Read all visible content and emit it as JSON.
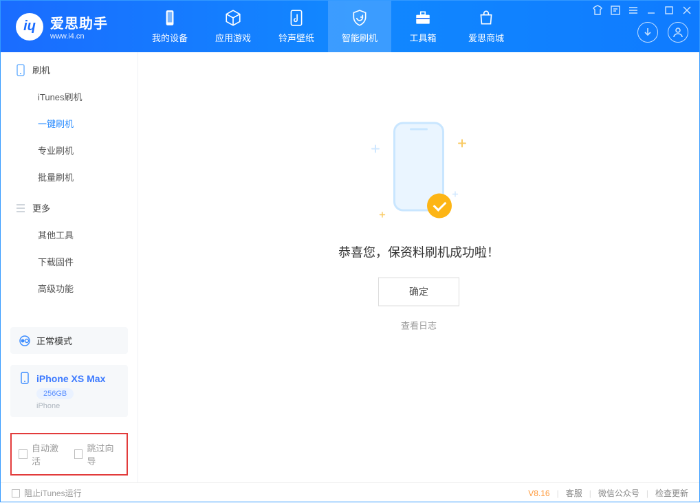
{
  "app": {
    "name": "爱思助手",
    "site": "www.i4.cn"
  },
  "nav": {
    "items": [
      {
        "label": "我的设备"
      },
      {
        "label": "应用游戏"
      },
      {
        "label": "铃声壁纸"
      },
      {
        "label": "智能刷机"
      },
      {
        "label": "工具箱"
      },
      {
        "label": "爱思商城"
      }
    ],
    "active_index": 3
  },
  "sidebar": {
    "sections": [
      {
        "title": "刷机",
        "items": [
          {
            "label": "iTunes刷机"
          },
          {
            "label": "一键刷机"
          },
          {
            "label": "专业刷机"
          },
          {
            "label": "批量刷机"
          }
        ],
        "active_index": 1
      },
      {
        "title": "更多",
        "items": [
          {
            "label": "其他工具"
          },
          {
            "label": "下载固件"
          },
          {
            "label": "高级功能"
          }
        ],
        "active_index": -1
      }
    ]
  },
  "device_panel": {
    "mode": "正常模式",
    "name": "iPhone XS Max",
    "capacity": "256GB",
    "type": "iPhone"
  },
  "checks": {
    "auto_activate": "自动激活",
    "skip_guide": "跳过向导"
  },
  "main": {
    "success_text": "恭喜您，保资料刷机成功啦！",
    "ok": "确定",
    "view_log": "查看日志"
  },
  "footer": {
    "block_itunes": "阻止iTunes运行",
    "version": "V8.16",
    "support": "客服",
    "wechat": "微信公众号",
    "update": "检查更新"
  }
}
